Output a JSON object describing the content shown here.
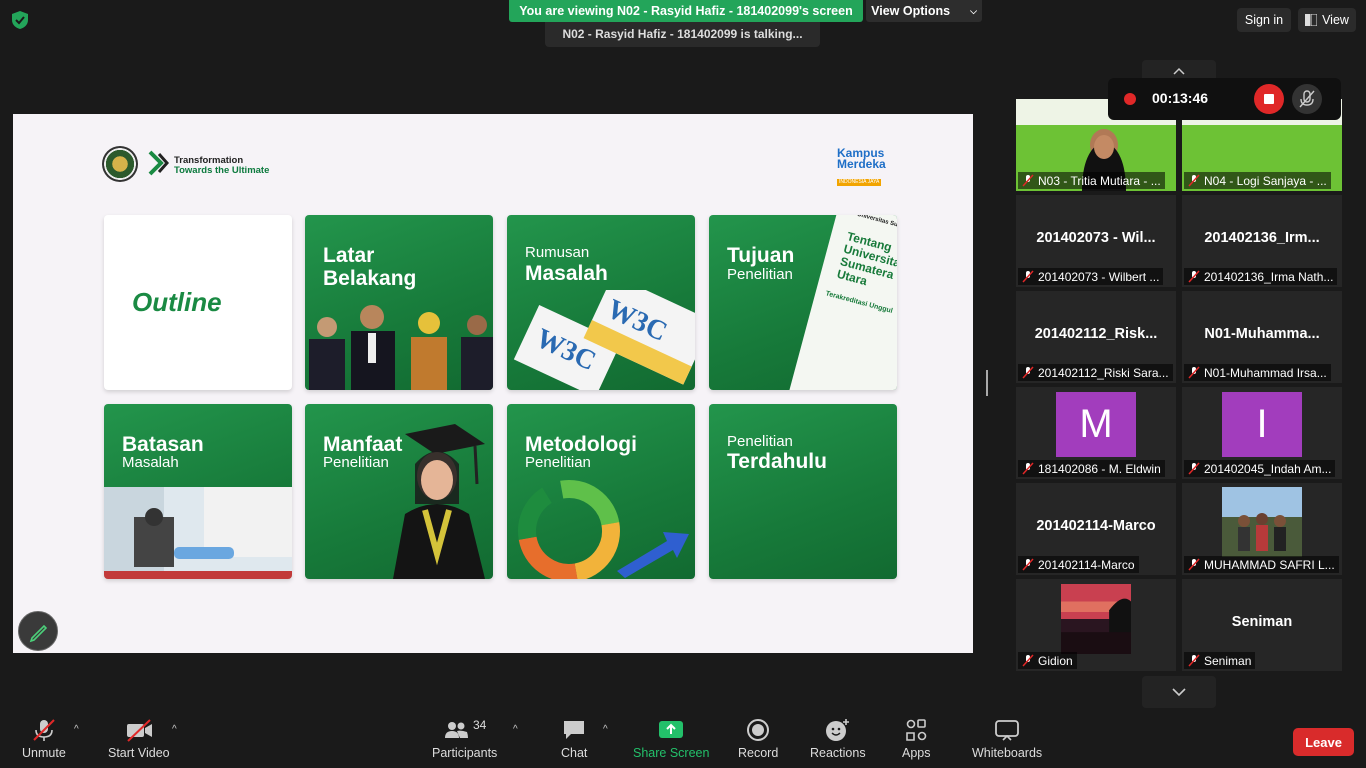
{
  "banner": {
    "viewing": "You are viewing N02 - Rasyid Hafiz - 181402099's screen",
    "view_options": "View Options",
    "talking": "N02 - Rasyid Hafiz - 181402099 is talking..."
  },
  "topright": {
    "sign_in": "Sign in",
    "view": "View"
  },
  "slide": {
    "transform_line1": "Transformation",
    "transform_line2": "Towards the Ultimate",
    "kampus1": "Kampus",
    "kampus2": "Merdeka",
    "kampus3": "INDONESIA JAYA",
    "cards": [
      {
        "line1": "Outline"
      },
      {
        "line1": "Latar",
        "line2": "Belakang"
      },
      {
        "line1": "Rumusan",
        "line2": "Masalah"
      },
      {
        "line1": "Tujuan",
        "line2": "Penelitian"
      },
      {
        "line1": "Batasan",
        "line2": "Masalah"
      },
      {
        "line1": "Manfaat",
        "line2": "Penelitian"
      },
      {
        "line1": "Metodologi",
        "line2": "Penelitian"
      },
      {
        "line1": "Penelitian",
        "line2": "Terdahulu"
      }
    ],
    "usu_card": {
      "title": "Tentang Universitas Sumatera Utara",
      "sub": "Terakreditasi Unggul",
      "logo": "Universitas Sumatera Utara"
    }
  },
  "recording": {
    "time": "00:13:46"
  },
  "participants": [
    {
      "big": "",
      "label": "N03 - Tritia Mutiara - ..."
    },
    {
      "big": "",
      "label": "N04 - Logi Sanjaya - ..."
    },
    {
      "big": "201402073 - Wil...",
      "label": "201402073 - Wilbert ..."
    },
    {
      "big": "201402136_Irm...",
      "label": "201402136_Irma Nath..."
    },
    {
      "big": "201402112_Risk...",
      "label": "201402112_Riski Sara..."
    },
    {
      "big": "N01-Muhamma...",
      "label": "N01-Muhammad Irsa..."
    },
    {
      "big": "M",
      "label": "181402086 - M. Eldwin"
    },
    {
      "big": "I",
      "label": "201402045_Indah Am..."
    },
    {
      "big": "201402114-Marco",
      "label": "201402114-Marco"
    },
    {
      "big": "",
      "label": "MUHAMMAD SAFRI L..."
    },
    {
      "big": "",
      "label": "Gidion"
    },
    {
      "big": "Seniman",
      "label": "Seniman"
    }
  ],
  "toolbar": {
    "unmute": "Unmute",
    "start_video": "Start Video",
    "participants": "Participants",
    "participant_count": "34",
    "chat": "Chat",
    "share_screen": "Share Screen",
    "record": "Record",
    "reactions": "Reactions",
    "apps": "Apps",
    "whiteboards": "Whiteboards",
    "leave": "Leave"
  },
  "colors": {
    "accent_green": "#23a55a",
    "leave_red": "#d92b2b",
    "slide_green": "#177a3a",
    "avatar_purple": "#a23dbd"
  }
}
